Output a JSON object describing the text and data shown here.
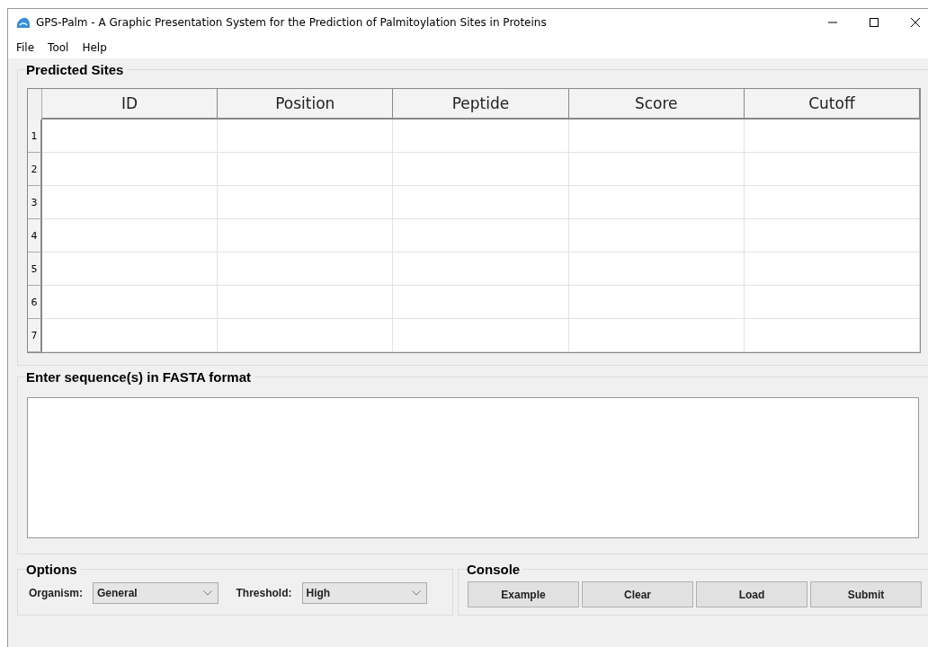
{
  "window": {
    "title": "GPS-Palm - A Graphic Presentation System for the Prediction of Palmitoylation Sites in Proteins"
  },
  "menu": [
    "File",
    "Tool",
    "Help"
  ],
  "predicted_sites": {
    "title": "Predicted Sites",
    "columns": [
      "ID",
      "Position",
      "Peptide",
      "Score",
      "Cutoff"
    ],
    "row_numbers": [
      "1",
      "2",
      "3",
      "4",
      "5",
      "6",
      "7"
    ]
  },
  "sequence_input": {
    "title": "Enter sequence(s) in FASTA format"
  },
  "options": {
    "title": "Options",
    "fields": [
      {
        "label": "Organism:",
        "value": "General"
      },
      {
        "label": "Threshold:",
        "value": "High"
      }
    ]
  },
  "console": {
    "title": "Console",
    "buttons": [
      "Example",
      "Clear",
      "Load",
      "Submit"
    ]
  }
}
